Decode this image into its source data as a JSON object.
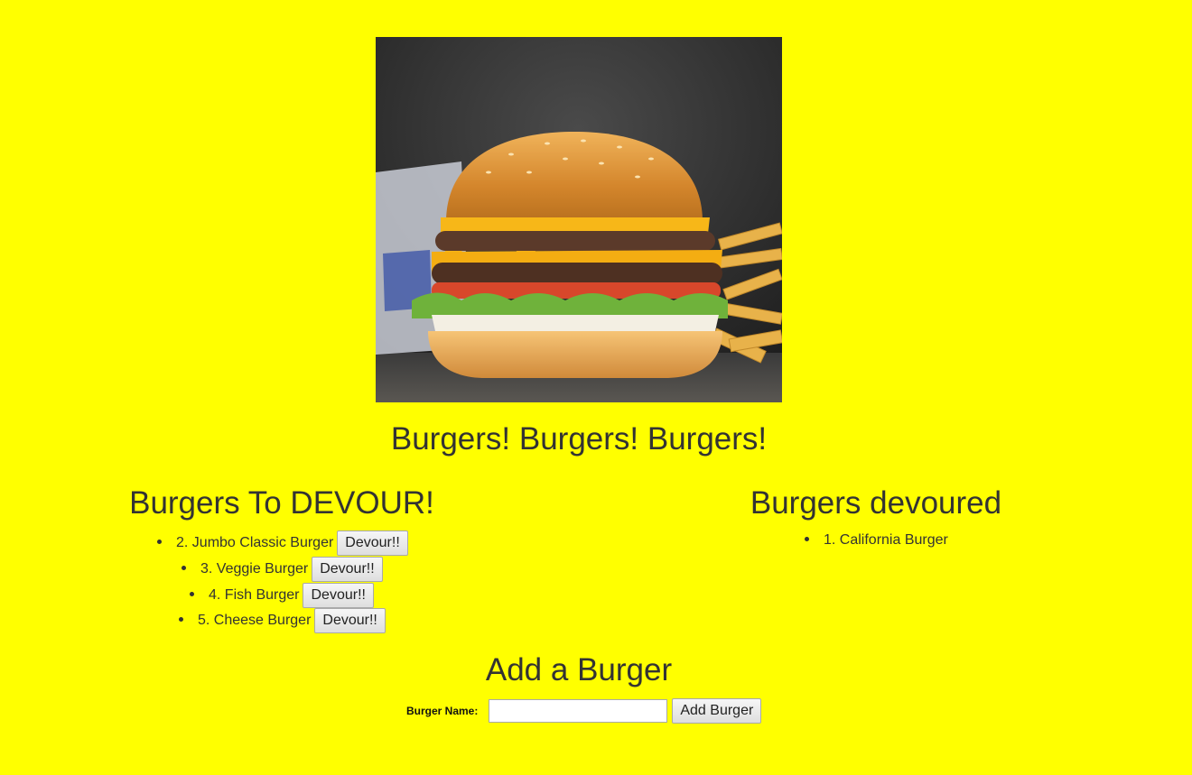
{
  "page": {
    "background_color": "#ffff00",
    "title": "Burgers! Burgers! Burgers!"
  },
  "hero": {
    "image": "burger-photo"
  },
  "to_devour": {
    "heading": "Burgers To DEVOUR!",
    "button_label": "Devour!!",
    "items": [
      {
        "label": "2. Jumbo Classic Burger"
      },
      {
        "label": "3. Veggie Burger"
      },
      {
        "label": "4. Fish Burger"
      },
      {
        "label": "5. Cheese Burger"
      }
    ]
  },
  "devoured": {
    "heading": "Burgers devoured",
    "items": [
      {
        "label": "1. California Burger"
      }
    ]
  },
  "add_form": {
    "heading": "Add a Burger",
    "label": "Burger Name:",
    "input_value": "",
    "submit_label": "Add Burger"
  }
}
